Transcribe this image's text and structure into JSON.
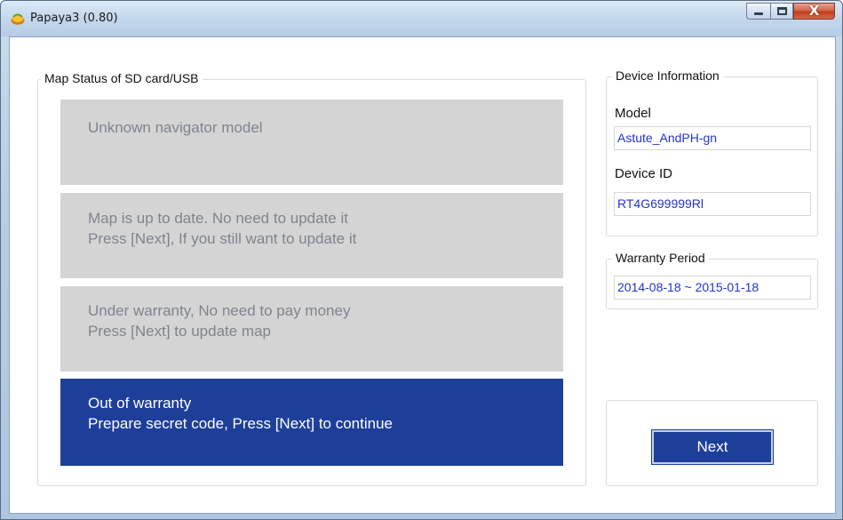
{
  "window": {
    "title": "Papaya3 (0.80)",
    "controls": {
      "minimize": "—",
      "maximize": "□",
      "close": "X"
    }
  },
  "map_status": {
    "title": "Map Status of SD card/USB",
    "panels": [
      {
        "lines": [
          "Unknown navigator model"
        ],
        "active": false
      },
      {
        "lines": [
          "Map is up to date. No need to update it",
          "Press [Next], If you still want to update it"
        ],
        "active": false
      },
      {
        "lines": [
          "Under warranty, No need to pay money",
          "Press [Next] to update map"
        ],
        "active": false
      },
      {
        "lines": [
          "Out of warranty",
          "Prepare secret code, Press [Next] to continue"
        ],
        "active": true
      }
    ]
  },
  "device_info": {
    "title": "Device Information",
    "model_label": "Model",
    "model_value": "Astute_AndPH-gn",
    "device_id_label": "Device ID",
    "device_id_value": "RT4G699999Rl"
  },
  "warranty": {
    "title": "Warranty Period",
    "value": "2014-08-18 ~ 2015-01-18"
  },
  "actions": {
    "next_label": "Next"
  },
  "colors": {
    "active_panel": "#1e3f99",
    "inactive_panel": "#d4d4d4",
    "value_text": "#2233cc"
  }
}
